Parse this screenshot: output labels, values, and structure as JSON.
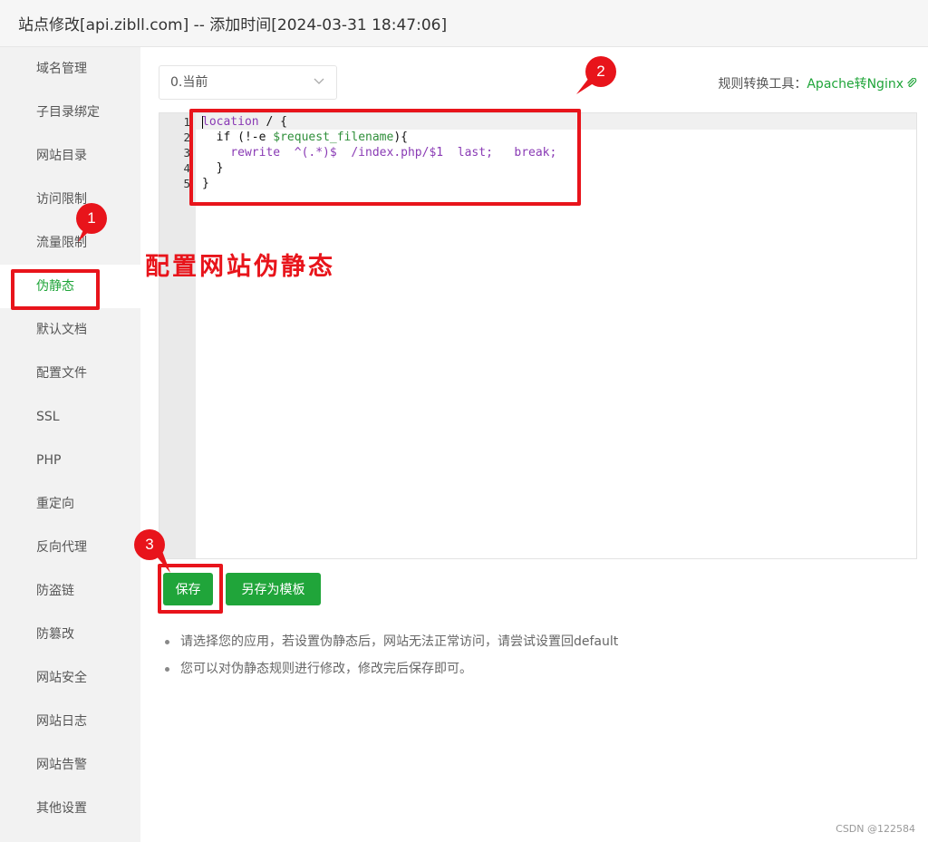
{
  "window": {
    "title": "站点修改[api.zibll.com] -- 添加时间[2024-03-31 18:47:06]"
  },
  "sidebar": {
    "items": [
      {
        "label": "域名管理"
      },
      {
        "label": "子目录绑定"
      },
      {
        "label": "网站目录"
      },
      {
        "label": "访问限制"
      },
      {
        "label": "流量限制"
      },
      {
        "label": "伪静态",
        "active": true
      },
      {
        "label": "默认文档"
      },
      {
        "label": "配置文件"
      },
      {
        "label": "SSL"
      },
      {
        "label": "PHP"
      },
      {
        "label": "重定向"
      },
      {
        "label": "反向代理"
      },
      {
        "label": "防盗链"
      },
      {
        "label": "防篡改"
      },
      {
        "label": "网站安全"
      },
      {
        "label": "网站日志"
      },
      {
        "label": "网站告警"
      },
      {
        "label": "其他设置"
      }
    ]
  },
  "toolbar": {
    "select_value": "0.当前",
    "tool_label": "规则转换工具：",
    "tool_link": "Apache转Nginx"
  },
  "editor": {
    "line_numbers": [
      "1",
      "2",
      "3",
      "4",
      "5"
    ],
    "lines": {
      "l1_kw": "location",
      "l1_rest": " / {",
      "l2_pre": "  if (!-e ",
      "l2_var": "$request_filename",
      "l2_post": "){",
      "l3": "    rewrite  ^(.*)$  /index.php/$1  last;   break;",
      "l4": "  }",
      "l5": "}"
    }
  },
  "buttons": {
    "save": "保存",
    "save_as_template": "另存为模板"
  },
  "tips": [
    "请选择您的应用，若设置伪静态后，网站无法正常访问，请尝试设置回default",
    "您可以对伪静态规则进行修改，修改完后保存即可。"
  ],
  "annotations": {
    "badge1": "1",
    "badge2": "2",
    "badge3": "3",
    "text": "配置网站伪静态"
  },
  "watermark": "CSDN @122584",
  "colors": {
    "accent": "#20a53a",
    "annotation": "#e8141b"
  }
}
